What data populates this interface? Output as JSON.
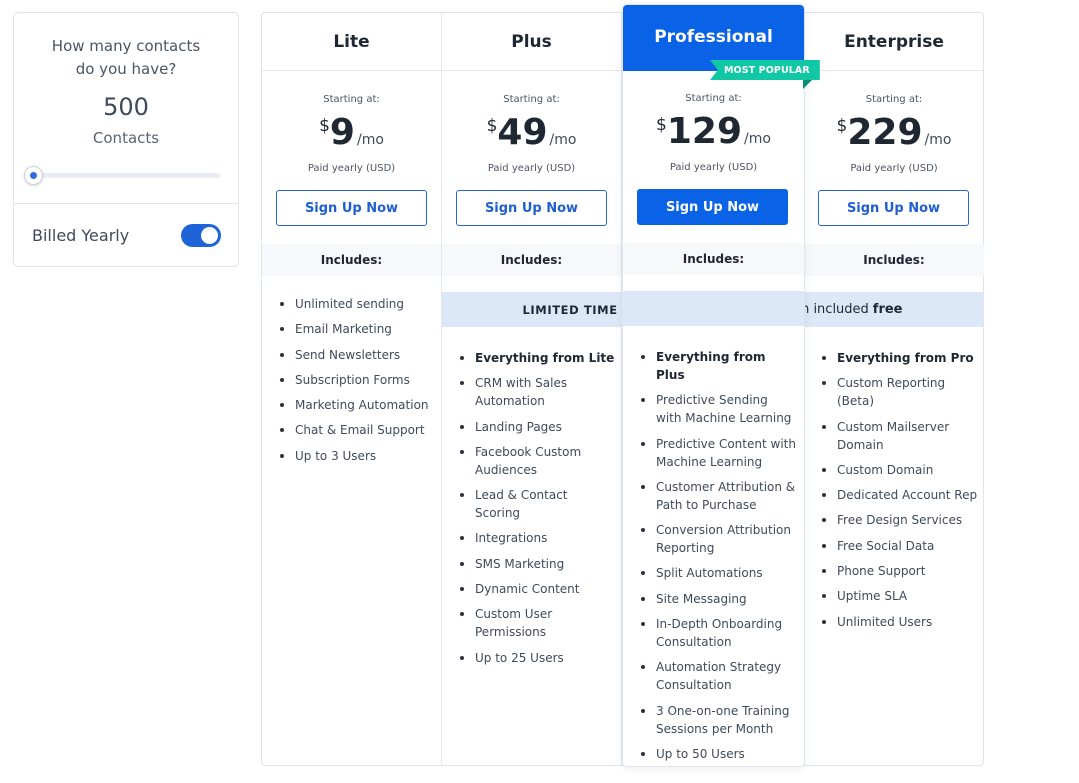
{
  "contacts": {
    "question": "How many contacts do you have?",
    "count": "500",
    "unit": "Contacts",
    "slider_fraction": 0.0
  },
  "billing": {
    "label": "Billed Yearly",
    "toggle_on": true
  },
  "labels": {
    "starting": "Starting at:",
    "currency": "$",
    "per": "/mo",
    "paid": "Paid yearly (USD)",
    "signup": "Sign Up Now",
    "includes": "Includes:"
  },
  "banner": {
    "tag": "LIMITED TIME",
    "text": "CRM with Sales Automation included",
    "free": "free"
  },
  "ribbon": "MOST POPULAR",
  "plans": [
    {
      "name": "Lite",
      "price": "9",
      "features": [
        "Unlimited sending",
        "Email Marketing",
        "Send Newsletters",
        "Subscription Forms",
        "Marketing Automation",
        "Chat & Email Support",
        "Up to 3 Users"
      ]
    },
    {
      "name": "Plus",
      "price": "49",
      "features": [
        "Everything from Lite",
        "CRM with Sales Automation",
        "Landing Pages",
        "Facebook Custom Audiences",
        "Lead & Contact Scoring",
        "Integrations",
        "SMS Marketing",
        "Dynamic Content",
        "Custom User Permissions",
        "Up to 25 Users"
      ]
    },
    {
      "name": "Professional",
      "price": "129",
      "features": [
        "Everything from Plus",
        "Predictive Sending with Machine Learning",
        "Predictive Content with Machine Learning",
        "Customer Attribution & Path to Purchase",
        "Conversion Attribution Reporting",
        "Split Automations",
        "Site Messaging",
        "In-Depth Onboarding Consultation",
        "Automation Strategy Consultation",
        "3 One-on-one Training Sessions per Month",
        "Up to 50 Users"
      ]
    },
    {
      "name": "Enterprise",
      "price": "229",
      "features": [
        "Everything from Pro",
        "Custom Reporting (Beta)",
        "Custom Mailserver Domain",
        "Custom Domain",
        "Dedicated Account Rep",
        "Free Design Services",
        "Free Social Data",
        "Phone Support",
        "Uptime SLA",
        "Unlimited Users"
      ]
    }
  ],
  "colors": {
    "accent": "#0a62e6",
    "ribbon": "#10c9a4",
    "banner_bg": "#dce8f8"
  }
}
